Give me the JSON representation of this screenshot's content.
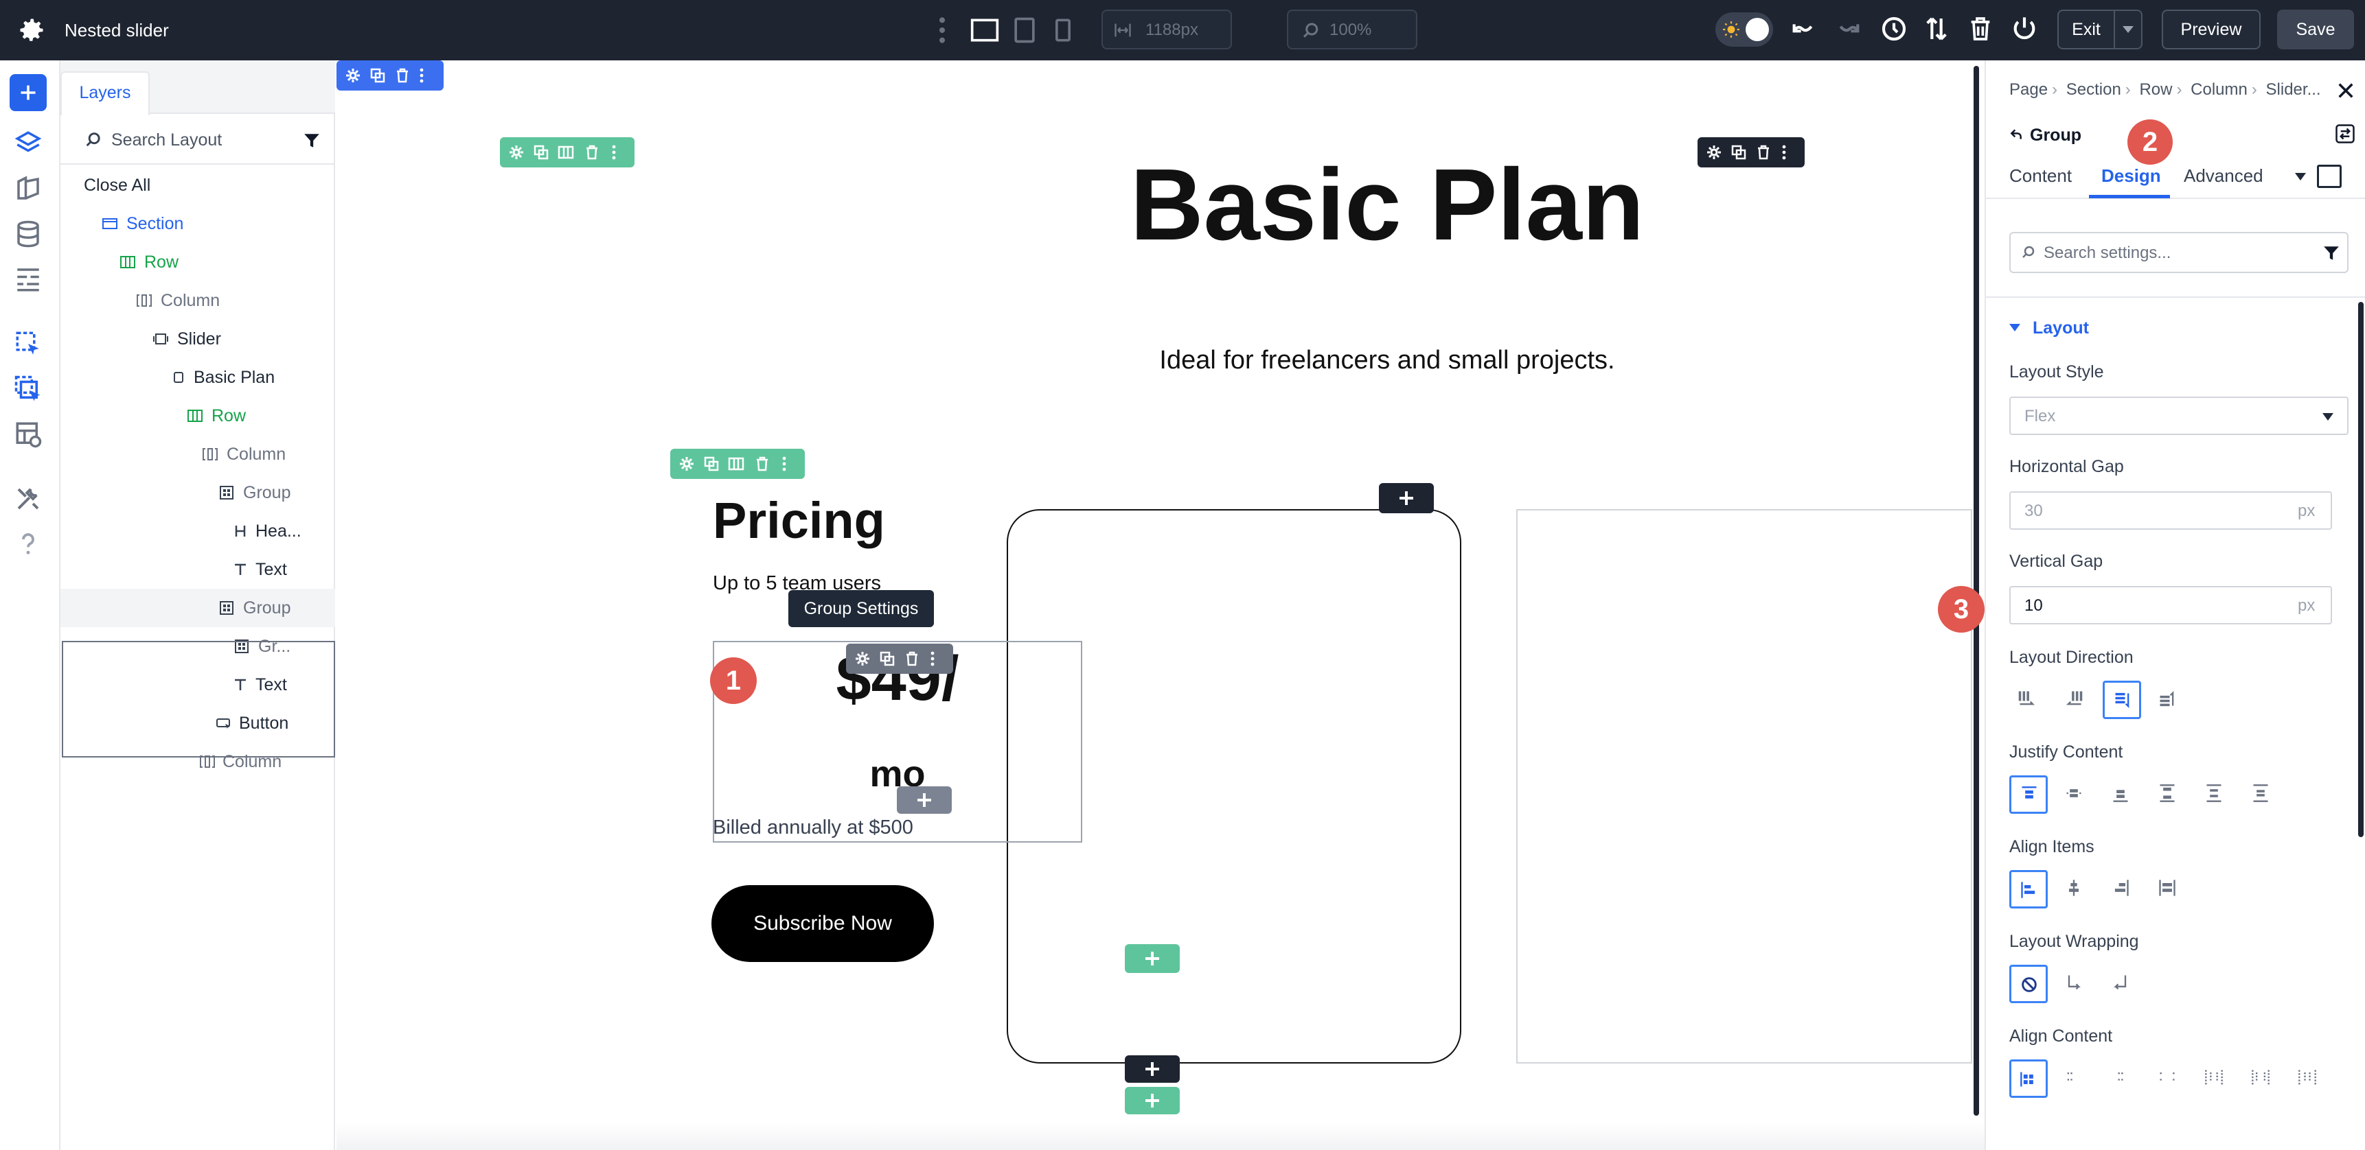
{
  "app": {
    "title": "Nested slider",
    "width_value": "1188px",
    "zoom_value": "100%",
    "exit_label": "Exit",
    "preview_label": "Preview",
    "save_label": "Save"
  },
  "layers": {
    "tab_label": "Layers",
    "search_placeholder": "Search Layout",
    "items": [
      {
        "label": "Close All",
        "icon": "none",
        "color": "default"
      },
      {
        "label": "Section",
        "icon": "section-icon",
        "color": "blue"
      },
      {
        "label": "Row",
        "icon": "row-icon",
        "color": "green"
      },
      {
        "label": "Column",
        "icon": "column-icon",
        "color": "grey"
      },
      {
        "label": "Slider",
        "icon": "slider-icon",
        "color": "default"
      },
      {
        "label": "Basic Plan",
        "icon": "slide-icon",
        "color": "default"
      },
      {
        "label": "Row",
        "icon": "row-icon",
        "color": "green"
      },
      {
        "label": "Column",
        "icon": "column-icon",
        "color": "grey"
      },
      {
        "label": "Group",
        "icon": "group-icon",
        "color": "grey"
      },
      {
        "label": "Hea...",
        "icon": "heading-icon",
        "color": "default"
      },
      {
        "label": "Text",
        "icon": "text-icon",
        "color": "default"
      },
      {
        "label": "Group",
        "icon": "group-icon",
        "color": "grey"
      },
      {
        "label": "Gr...",
        "icon": "group-icon",
        "color": "grey"
      },
      {
        "label": "Text",
        "icon": "text-icon",
        "color": "default"
      },
      {
        "label": "Button",
        "icon": "button-icon",
        "color": "default"
      },
      {
        "label": "Column",
        "icon": "column-icon",
        "color": "grey"
      }
    ]
  },
  "canvas": {
    "heading": "Basic Plan",
    "subtitle": "Ideal for freelancers and small projects.",
    "card": {
      "title": "Pricing",
      "users": "Up to 5 team users",
      "tooltip": "Group Settings",
      "price": "$49/",
      "period": "mo",
      "billed": "Billed annually at $500",
      "button": "Subscribe Now"
    },
    "callouts": [
      "1",
      "2",
      "3"
    ]
  },
  "settings": {
    "breadcrumb": [
      "Page",
      "Section",
      "Row",
      "Column",
      "Slider..."
    ],
    "element_title": "Group",
    "tabs": [
      "Content",
      "Design",
      "Advanced"
    ],
    "active_tab": "Design",
    "search_placeholder": "Search settings...",
    "section_title": "Layout",
    "layout_style_label": "Layout Style",
    "layout_style_value": "Flex",
    "horizontal_gap_label": "Horizontal Gap",
    "horizontal_gap_placeholder": "30",
    "horizontal_gap_unit": "px",
    "vertical_gap_label": "Vertical Gap",
    "vertical_gap_value": "10",
    "vertical_gap_unit": "px",
    "layout_direction_label": "Layout Direction",
    "justify_content_label": "Justify Content",
    "align_items_label": "Align Items",
    "layout_wrapping_label": "Layout Wrapping",
    "align_content_label": "Align Content"
  },
  "colors": {
    "topbar": "#1e2430",
    "accent_blue": "#2563eb",
    "accent_green": "#5ec49c",
    "callout_red": "#e0584f"
  }
}
